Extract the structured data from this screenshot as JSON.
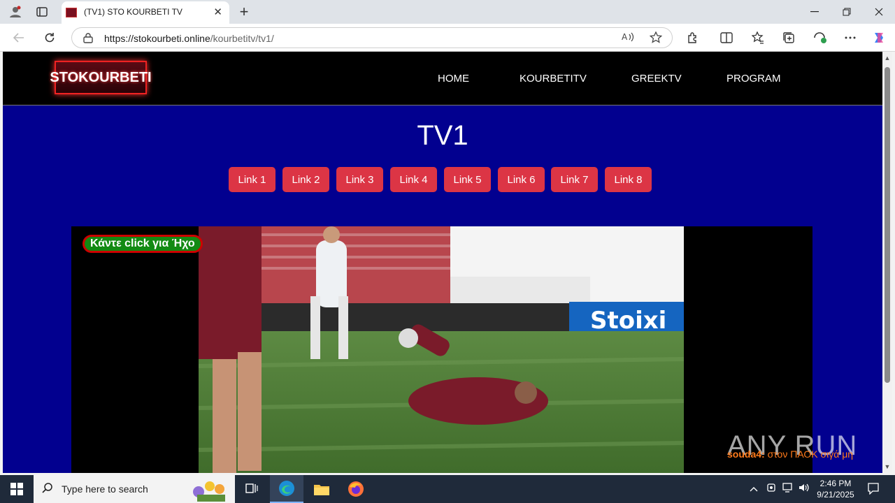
{
  "browser": {
    "tab_title": "(TV1) STO KOURBETI TV",
    "tab_close": "✕",
    "new_tab": "+",
    "url_host": "https://stokourbeti.online",
    "url_path": "/kourbetitv/tv1/"
  },
  "site": {
    "logo_text": "STOKOURBETI",
    "nav": [
      "HOME",
      "KOURBETITV",
      "GREEKTV",
      "PROGRAM"
    ],
    "title": "TV1",
    "links": [
      "Link 1",
      "Link 2",
      "Link 3",
      "Link 4",
      "Link 5",
      "Link 6",
      "Link 7",
      "Link 8"
    ],
    "link_color": "#dc3545",
    "background_color": "#02008f"
  },
  "player": {
    "sound_button": "Κάντε click για Ήχο",
    "ticker_user": "souda4:",
    "ticker_text": "στον ΠΑΟΚ σιγά μη",
    "watermark": "ANY RUN",
    "video_billboard": "Stoixi"
  },
  "taskbar": {
    "search_placeholder": "Type here to search",
    "time": "2:46 PM",
    "date": "9/21/2025"
  }
}
